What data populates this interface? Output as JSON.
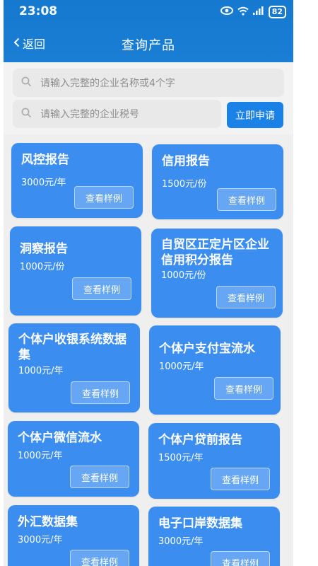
{
  "status": {
    "time": "23:08",
    "battery": "82"
  },
  "header": {
    "back_label": "返回",
    "title": "查询产品"
  },
  "search": {
    "name_placeholder": "请输入完整的企业名称或4个字",
    "tax_placeholder": "请输入完整的企业税号",
    "apply_label": "立即申请"
  },
  "products": [
    {
      "title": "风控报告",
      "price": "3000元/年",
      "button": "查看样例"
    },
    {
      "title": "信用报告",
      "price": "1500元/份",
      "button": "查看样例"
    },
    {
      "title": "洞察报告",
      "price": "1000元/份",
      "button": "查看样例"
    },
    {
      "title": "自贸区正定片区企业信用积分报告",
      "price": "1000元/份",
      "button": "查看样例"
    },
    {
      "title": "个体户收银系统数据集",
      "price": "1000元/年",
      "button": "查看样例"
    },
    {
      "title": "个体户支付宝流水",
      "price": "1000元/年",
      "button": "查看样例"
    },
    {
      "title": "个体户微信流水",
      "price": "1000元/年",
      "button": "查看样例"
    },
    {
      "title": "个体户贷前报告",
      "price": "1500元/年",
      "button": "查看样例"
    },
    {
      "title": "外汇数据集",
      "price": "3000元/年",
      "button": "查看样例"
    },
    {
      "title": "电子口岸数据集",
      "price": "3000元/年",
      "button": "查看样例"
    }
  ]
}
